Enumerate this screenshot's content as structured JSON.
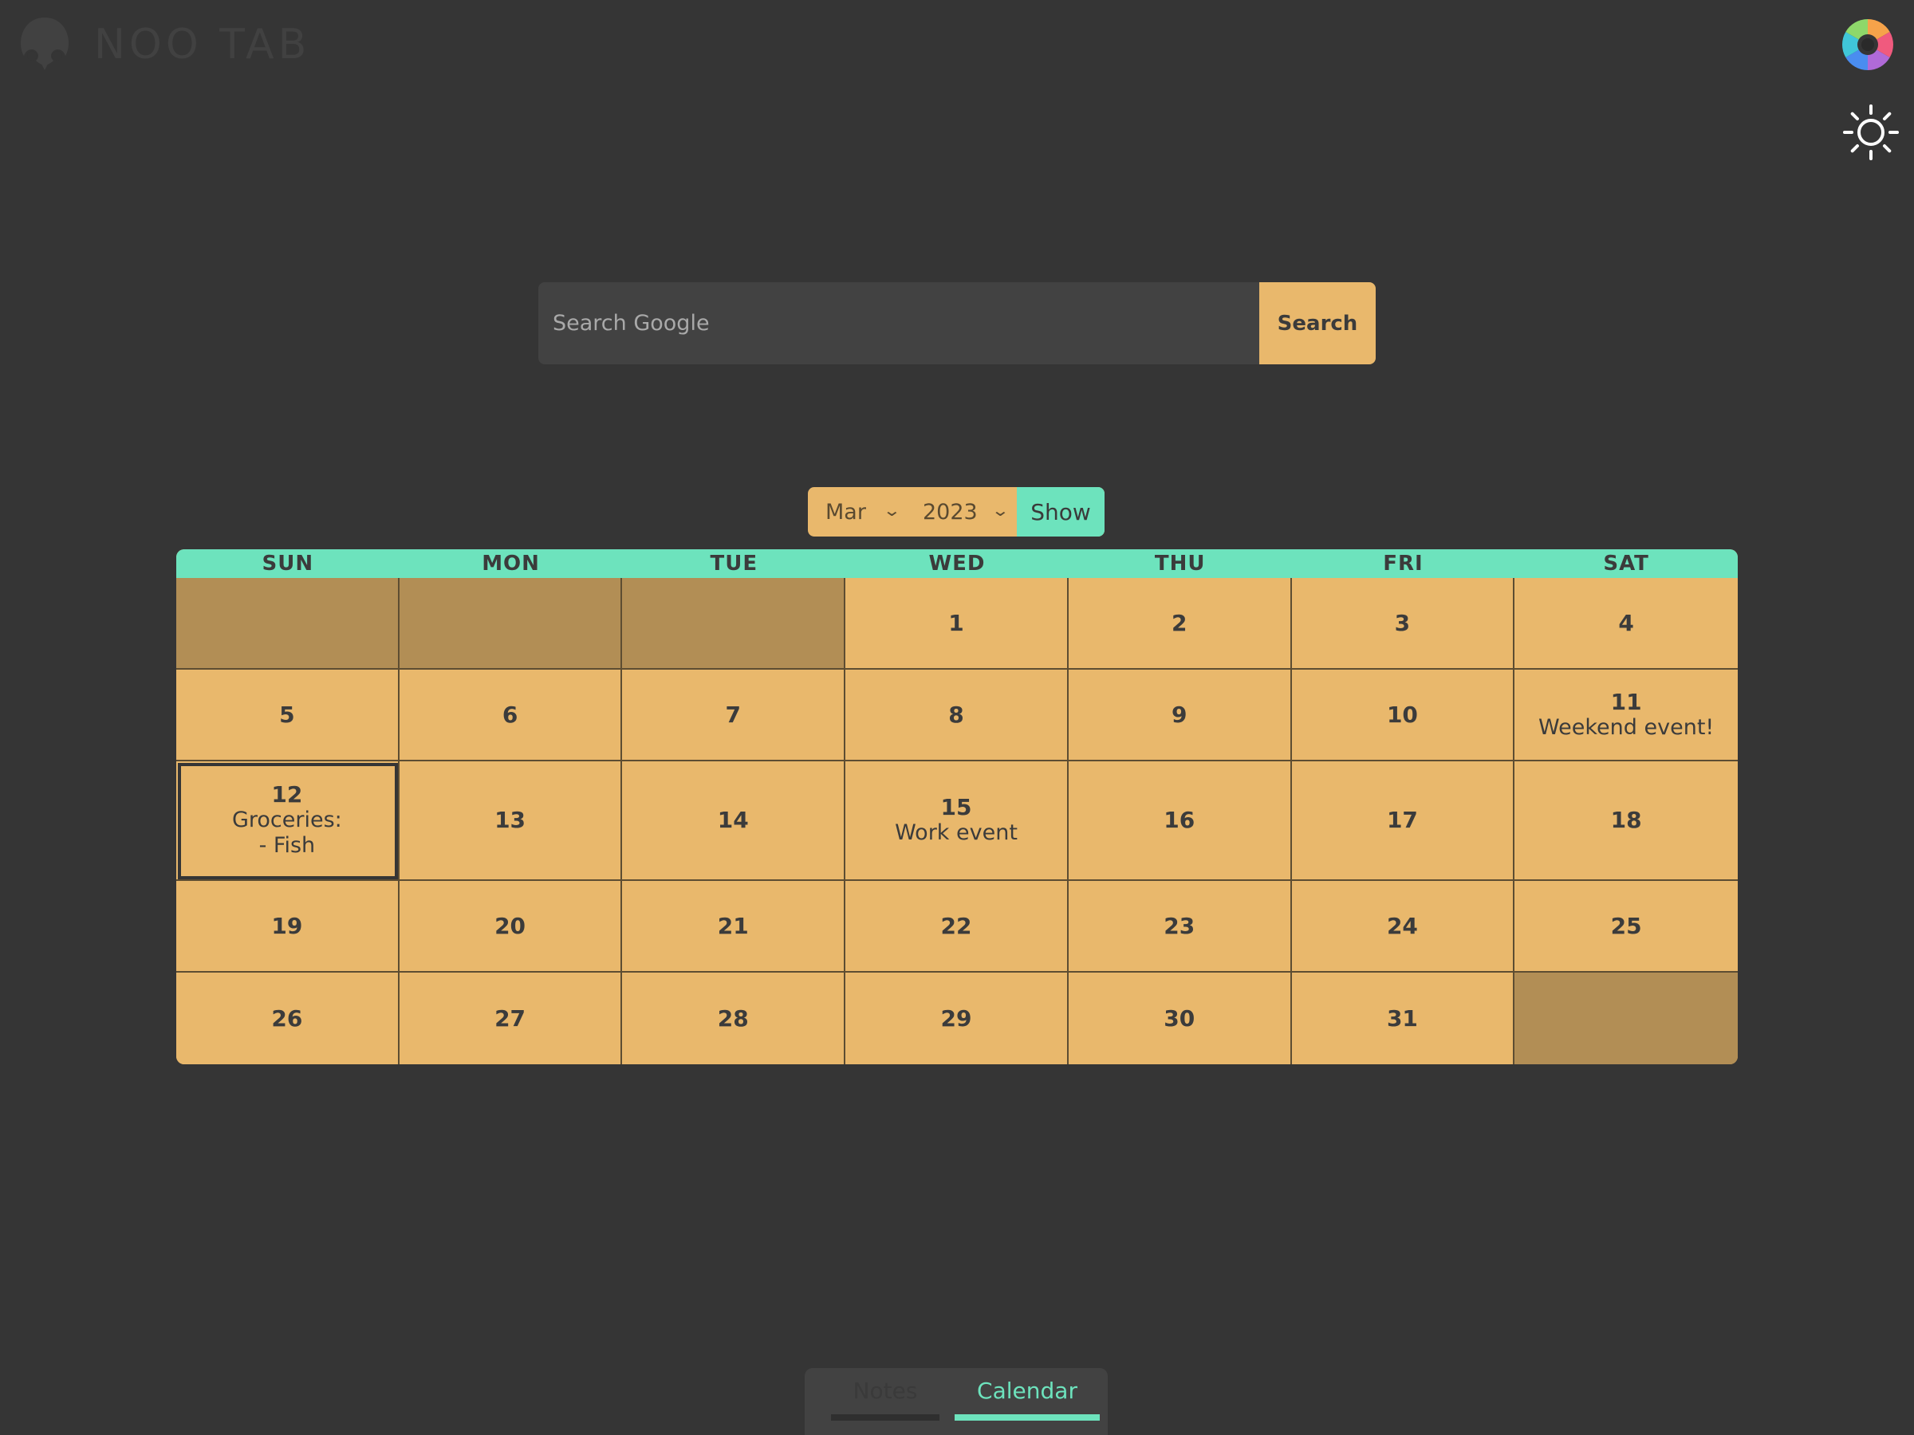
{
  "app": {
    "logo_text": "NOO TAB",
    "logo_icon": "penguin-icon",
    "theme_icon": "sun-icon",
    "color_icon": "color-wheel-icon"
  },
  "search": {
    "placeholder": "Search Google",
    "value": "",
    "button_label": "Search"
  },
  "selector": {
    "month": "Mar",
    "year": "2023",
    "show_label": "Show"
  },
  "calendar": {
    "weekdays": [
      "SUN",
      "MON",
      "TUE",
      "WED",
      "THU",
      "FRI",
      "SAT"
    ],
    "days": [
      {
        "day": "",
        "note": ""
      },
      {
        "day": "",
        "note": ""
      },
      {
        "day": "",
        "note": ""
      },
      {
        "day": "1",
        "note": ""
      },
      {
        "day": "2",
        "note": ""
      },
      {
        "day": "3",
        "note": ""
      },
      {
        "day": "4",
        "note": ""
      },
      {
        "day": "5",
        "note": ""
      },
      {
        "day": "6",
        "note": ""
      },
      {
        "day": "7",
        "note": ""
      },
      {
        "day": "8",
        "note": ""
      },
      {
        "day": "9",
        "note": ""
      },
      {
        "day": "10",
        "note": ""
      },
      {
        "day": "11",
        "note": "Weekend event!"
      },
      {
        "day": "12",
        "note": "Groceries:\n- Fish"
      },
      {
        "day": "13",
        "note": ""
      },
      {
        "day": "14",
        "note": ""
      },
      {
        "day": "15",
        "note": "Work event"
      },
      {
        "day": "16",
        "note": ""
      },
      {
        "day": "17",
        "note": ""
      },
      {
        "day": "18",
        "note": ""
      },
      {
        "day": "19",
        "note": ""
      },
      {
        "day": "20",
        "note": ""
      },
      {
        "day": "21",
        "note": ""
      },
      {
        "day": "22",
        "note": ""
      },
      {
        "day": "23",
        "note": ""
      },
      {
        "day": "24",
        "note": ""
      },
      {
        "day": "25",
        "note": ""
      },
      {
        "day": "26",
        "note": ""
      },
      {
        "day": "27",
        "note": ""
      },
      {
        "day": "28",
        "note": ""
      },
      {
        "day": "29",
        "note": ""
      },
      {
        "day": "30",
        "note": ""
      },
      {
        "day": "31",
        "note": ""
      },
      {
        "day": "",
        "note": ""
      }
    ],
    "today": "12"
  },
  "tabs": {
    "notes_label": "Notes",
    "calendar_label": "Calendar",
    "active": "Calendar"
  },
  "colors": {
    "background": "#353535",
    "cell": "#e9b86c",
    "cell_empty": "#b28e55",
    "accent": "#6de3bd"
  }
}
